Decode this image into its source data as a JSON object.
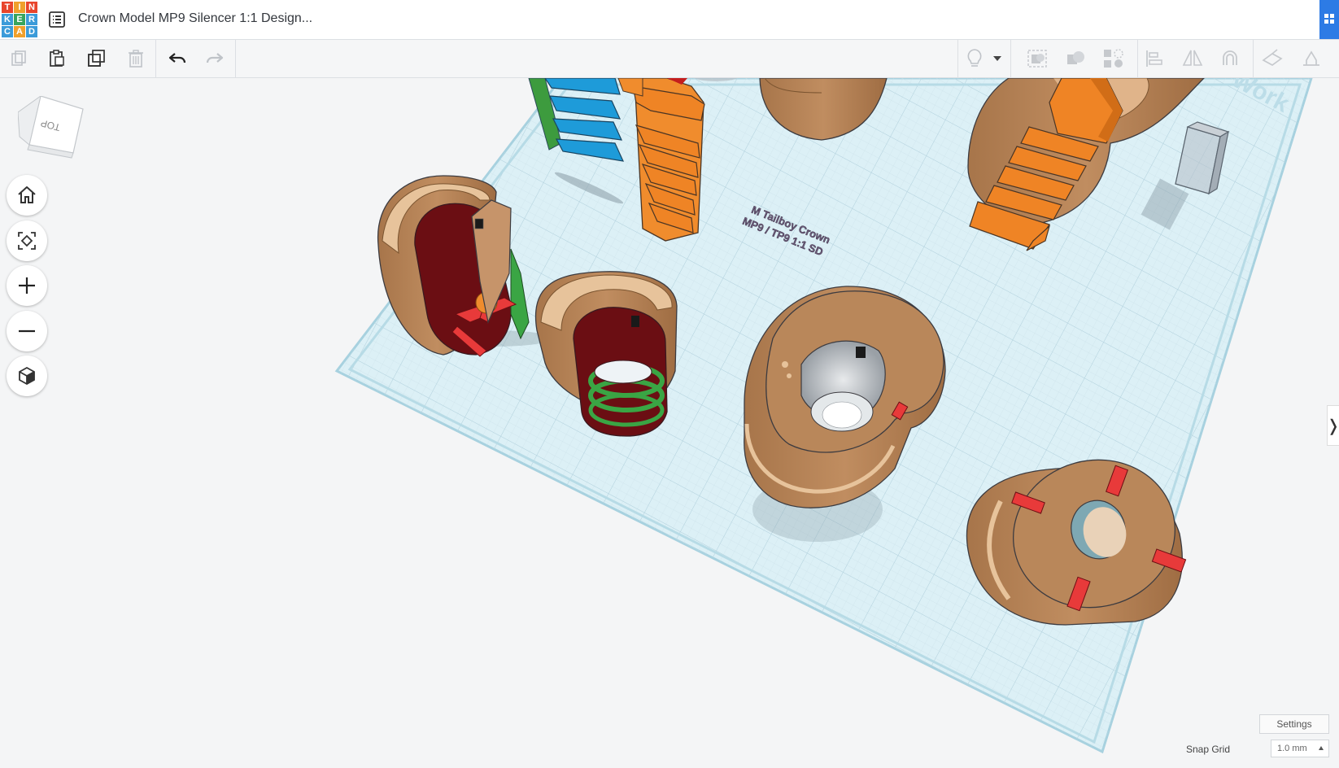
{
  "app": {
    "logo_letters": [
      "T",
      "I",
      "N",
      "K",
      "E",
      "R",
      "C",
      "A",
      "D"
    ],
    "logo_colors": [
      "#e8452c",
      "#f0a02b",
      "#e8452c",
      "#3b9bd9",
      "#38a55d",
      "#3b9bd9",
      "#3b9bd9",
      "#f0a02b",
      "#3b9bd9"
    ],
    "design_title": "Crown Model MP9 Silencer 1:1 Design..."
  },
  "toolbar": {
    "left_icons": [
      "copy-icon",
      "paste-icon",
      "duplicate-icon",
      "delete-icon",
      "undo-icon",
      "redo-icon"
    ],
    "right_icons": [
      "lightbulb-icon",
      "chevron-down-icon",
      "group-icon",
      "ungroup-icon",
      "hole-icon",
      "align-icon",
      "mirror-icon",
      "cruise-icon",
      "workplane-icon",
      "ruler-icon"
    ]
  },
  "viewcube": {
    "face": "TOP"
  },
  "view_controls": [
    "home-icon",
    "fit-view-icon",
    "zoom-in-icon",
    "zoom-out-icon",
    "perspective-icon"
  ],
  "scene": {
    "engraved_text_line1": "M Tailboy Crown",
    "engraved_text_line2": "MP9 / TP9 1:1 SD",
    "workplane_watermark": "Work",
    "colors": {
      "tan": "#b9875a",
      "tan_light": "#e7c39b",
      "orange": "#ef8425",
      "blue": "#1e9bd9",
      "green": "#3da54a",
      "maroon": "#6d0f16",
      "red": "#e83a3a",
      "grid_bg": "#d8ecf2"
    }
  },
  "footer": {
    "settings_label": "Settings",
    "snap_label": "Snap Grid",
    "snap_value": "1.0 mm"
  }
}
